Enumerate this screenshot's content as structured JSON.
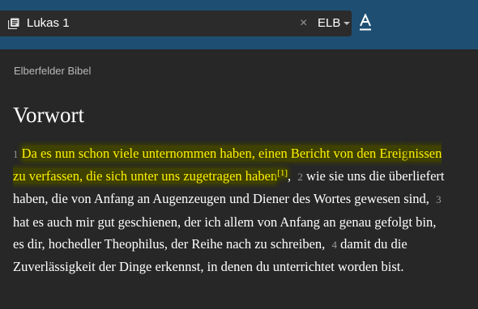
{
  "topbar": {
    "search_value": "Lukas 1",
    "clear_symbol": "×",
    "version": "ELB",
    "icons": {
      "book": "book-list-icon",
      "clear": "close-icon",
      "caret": "chevron-down-icon",
      "font": "font-settings-icon"
    }
  },
  "content": {
    "translation_name": "Elberfelder Bibel",
    "heading": "Vorwort",
    "verses": [
      {
        "num": "1",
        "parts": [
          "Da es nun schon viele unternommen haben, einen Bericht von den Ereig­",
          "nissen zu verfassen, die sich unter uns zugetragen haben"
        ],
        "footnote": "[1]",
        "highlighted": true
      },
      {
        "num": "2",
        "text": "wie sie uns die überliefert haben, die von Anfang an Augenzeugen und Diener des Wortes gewesen sind,"
      },
      {
        "num": "3",
        "text": "hat es auch mir gut geschienen, der ich allem von Anfang an genau gefolgt bin, es dir, hochedler Theophilus, der Reihe nach zu schreiben,"
      },
      {
        "num": "4",
        "text": "damit du die Zuverlässigkeit der Dinge erkennst, in denen du unterrichtet worden bist."
      }
    ]
  },
  "colors": {
    "topbar_bg": "#1e4f72",
    "page_bg": "#272727",
    "highlight_text": "#fff200",
    "highlight_bg": "#3f4100"
  }
}
